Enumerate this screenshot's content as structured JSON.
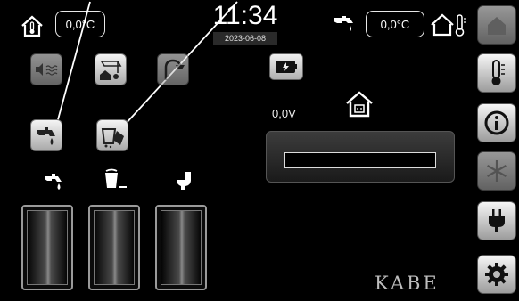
{
  "header": {
    "inside_temp": "0,0°C",
    "outside_temp": "0,0°C",
    "time": "11:34",
    "date": "2023-06-08"
  },
  "battery": {
    "voltage": "0,0V",
    "level_fraction": 0
  },
  "tanks": [
    {
      "name": "fresh-water",
      "level_fraction": 0
    },
    {
      "name": "grey-water",
      "level_fraction": 0
    },
    {
      "name": "toilet",
      "level_fraction": 0
    }
  ],
  "sidebar": {
    "items": [
      {
        "name": "home",
        "icon": "home-icon"
      },
      {
        "name": "temperature",
        "icon": "thermometer-icon"
      },
      {
        "name": "info",
        "icon": "info-icon"
      },
      {
        "name": "climate",
        "icon": "snowflake-icon"
      },
      {
        "name": "power",
        "icon": "plug-icon"
      },
      {
        "name": "settings",
        "icon": "gear-icon"
      }
    ]
  },
  "brand": "KABE",
  "colors": {
    "background": "#000000",
    "button_light": "#f4f4f4",
    "button_dark": "#a9a9a9",
    "bar_fill": "#3b9be0"
  }
}
